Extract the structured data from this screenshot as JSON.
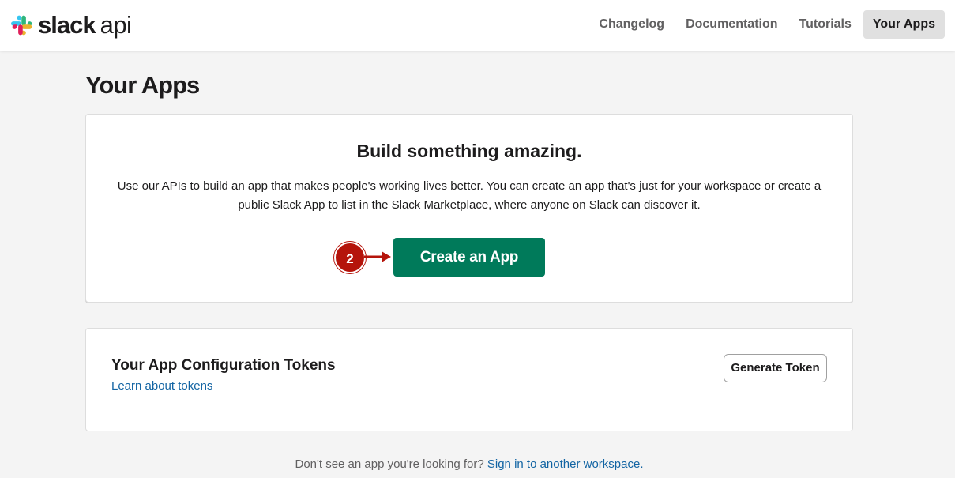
{
  "header": {
    "logo_slack": "slack",
    "logo_api": "api",
    "nav": [
      {
        "label": "Changelog",
        "active": false
      },
      {
        "label": "Documentation",
        "active": false
      },
      {
        "label": "Tutorials",
        "active": false
      },
      {
        "label": "Your Apps",
        "active": true
      }
    ]
  },
  "page": {
    "title": "Your Apps"
  },
  "build_card": {
    "heading": "Build something amazing.",
    "description": "Use our APIs to build an app that makes people's working lives better. You can create an app that's just for your workspace or create a public Slack App to list in the Slack Marketplace, where anyone on Slack can discover it.",
    "create_button": "Create an App",
    "step_badge": "2"
  },
  "tokens_card": {
    "heading": "Your App Configuration Tokens",
    "link": "Learn about tokens",
    "generate_button": "Generate Token"
  },
  "footer": {
    "text": "Don't see an app you're looking for?",
    "link": "Sign in to another workspace."
  },
  "colors": {
    "primary_green": "#007a5a",
    "link_blue": "#1264a3",
    "badge_red": "#b5140b",
    "slack_blue": "#36c5f0",
    "slack_green": "#2eb67d",
    "slack_yellow": "#ecb22e",
    "slack_red": "#e01e5a"
  },
  "icons": [
    "slack-logo-icon",
    "arrow-right-icon"
  ]
}
